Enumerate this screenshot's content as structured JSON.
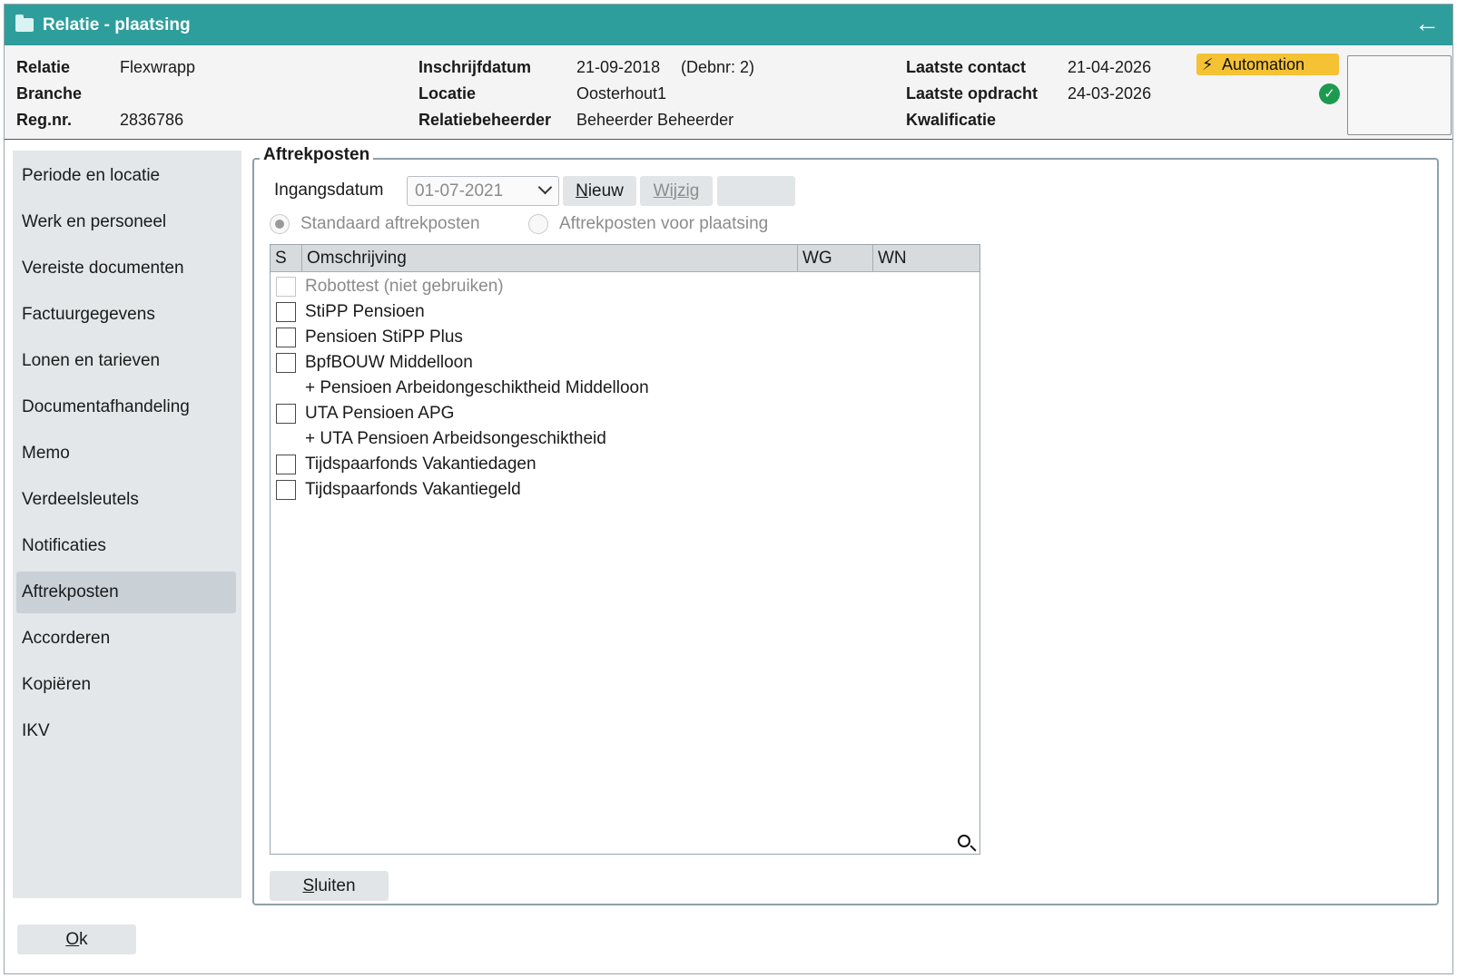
{
  "window": {
    "title": "Relatie - plaatsing"
  },
  "header": {
    "relatie_label": "Relatie",
    "relatie_value": "Flexwrapp",
    "branche_label": "Branche",
    "branche_value": "",
    "regnr_label": "Reg.nr.",
    "regnr_value": "2836786",
    "inschrijfdatum_label": "Inschrijfdatum",
    "inschrijfdatum_value": "21-09-2018",
    "debnr": "(Debnr: 2)",
    "locatie_label": "Locatie",
    "locatie_value": "Oosterhout1",
    "relatiebeheerder_label": "Relatiebeheerder",
    "relatiebeheerder_value": "Beheerder Beheerder",
    "laatste_contact_label": "Laatste contact",
    "laatste_contact_value": "21-04-2026",
    "laatste_opdracht_label": "Laatste opdracht",
    "laatste_opdracht_value": "24-03-2026",
    "kwalificatie_label": "Kwalificatie",
    "kwalificatie_value": "",
    "automation_badge": "Automation",
    "colors": {
      "titlebar": "#2e9e9c",
      "badge": "#f5c233",
      "status_ok": "#1c9a4f"
    }
  },
  "sidebar": {
    "items": [
      {
        "label": "Periode en locatie"
      },
      {
        "label": "Werk en personeel"
      },
      {
        "label": "Vereiste documenten"
      },
      {
        "label": "Factuurgegevens"
      },
      {
        "label": "Lonen en tarieven"
      },
      {
        "label": "Documentafhandeling"
      },
      {
        "label": "Memo"
      },
      {
        "label": "Verdeelsleutels"
      },
      {
        "label": "Notificaties"
      },
      {
        "label": "Aftrekposten",
        "active": true
      },
      {
        "label": "Accorderen"
      },
      {
        "label": "Kopiëren"
      },
      {
        "label": "IKV"
      }
    ]
  },
  "aftrekposten": {
    "legend": "Aftrekposten",
    "ingangsdatum_label": "Ingangsdatum",
    "ingangsdatum_value": "01-07-2021",
    "nieuw_first": "N",
    "nieuw_rest": "ieuw",
    "wijzig_label": "Wijzig",
    "radio_standaard": "Standaard aftrekposten",
    "radio_plaatsing": "Aftrekposten voor plaatsing",
    "table": {
      "headers": [
        "S",
        "Omschrijving",
        "WG",
        "WN"
      ],
      "rows": [
        {
          "text": "Robottest (niet gebruiken)",
          "checkbox": true,
          "dim": true
        },
        {
          "text": "StiPP Pensioen",
          "checkbox": true
        },
        {
          "text": "Pensioen StiPP Plus",
          "checkbox": true
        },
        {
          "text": "BpfBOUW Middelloon",
          "checkbox": true
        },
        {
          "text": "+ Pensioen Arbeidongeschiktheid Middelloon",
          "checkbox": false
        },
        {
          "text": "UTA Pensioen APG",
          "checkbox": true
        },
        {
          "text": "+ UTA Pensioen Arbeidsongeschiktheid",
          "checkbox": false
        },
        {
          "text": "Tijdspaarfonds Vakantiedagen",
          "checkbox": true
        },
        {
          "text": "Tijdspaarfonds Vakantiegeld",
          "checkbox": true
        }
      ]
    },
    "sluiten_first": "S",
    "sluiten_rest": "luiten"
  },
  "footer": {
    "ok_first": "O",
    "ok_rest": "k"
  }
}
